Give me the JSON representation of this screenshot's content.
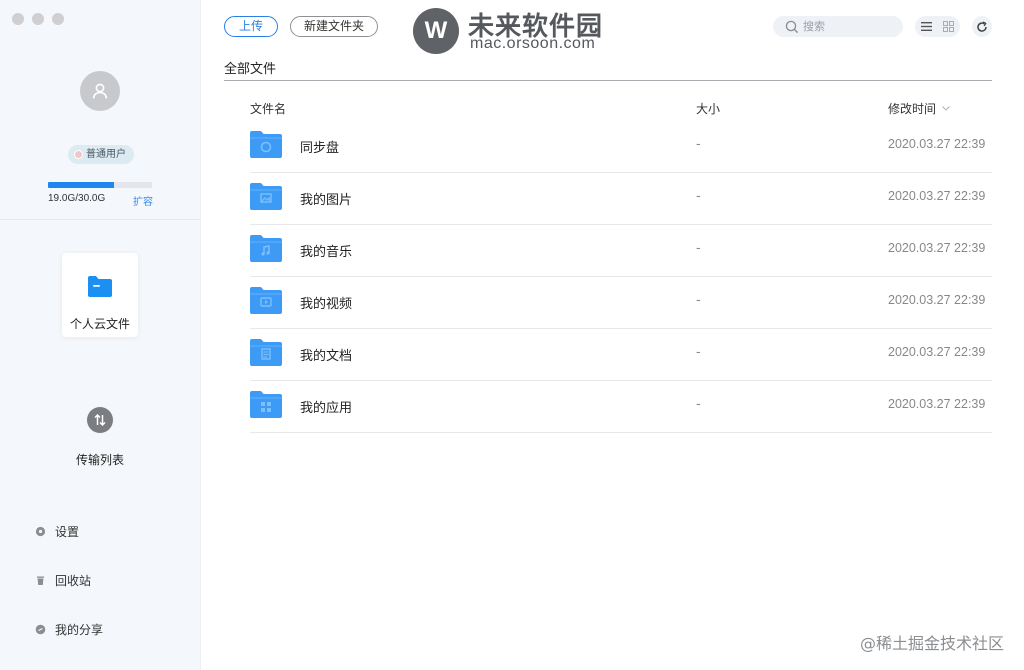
{
  "sidebar": {
    "user_badge": "普通用户",
    "storage_used_text": "19.0G/30.0G",
    "storage_used_fraction": 0.633,
    "expand_label": "扩容",
    "nav": {
      "cloud_files_label": "个人云文件",
      "transfer_list_label": "传输列表"
    },
    "bottom_items": [
      {
        "label": "设置",
        "icon": "gear-icon"
      },
      {
        "label": "回收站",
        "icon": "trash-icon"
      },
      {
        "label": "我的分享",
        "icon": "share-icon"
      }
    ]
  },
  "toolbar": {
    "upload_label": "上传",
    "new_folder_label": "新建文件夹",
    "search_placeholder": "搜索"
  },
  "watermark": {
    "logo_letter": "W",
    "site_name": "未来软件园",
    "site_url": "mac.orsoon.com"
  },
  "breadcrumb": "全部文件",
  "table": {
    "headers": {
      "name": "文件名",
      "size": "大小",
      "modified": "修改时间"
    },
    "rows": [
      {
        "name": "同步盘",
        "size": "-",
        "modified": "2020.03.27 22:39",
        "icon": "sync-folder-icon"
      },
      {
        "name": "我的图片",
        "size": "-",
        "modified": "2020.03.27 22:39",
        "icon": "image-folder-icon"
      },
      {
        "name": "我的音乐",
        "size": "-",
        "modified": "2020.03.27 22:39",
        "icon": "music-folder-icon"
      },
      {
        "name": "我的视频",
        "size": "-",
        "modified": "2020.03.27 22:39",
        "icon": "video-folder-icon"
      },
      {
        "name": "我的文档",
        "size": "-",
        "modified": "2020.03.27 22:39",
        "icon": "document-folder-icon"
      },
      {
        "name": "我的应用",
        "size": "-",
        "modified": "2020.03.27 22:39",
        "icon": "app-folder-icon"
      }
    ]
  },
  "footer_watermark": "@稀土掘金技术社区",
  "colors": {
    "accent": "#2a7fe8",
    "folder": "#3d9bf5",
    "sidebar_bg": "#f4f7fb"
  }
}
